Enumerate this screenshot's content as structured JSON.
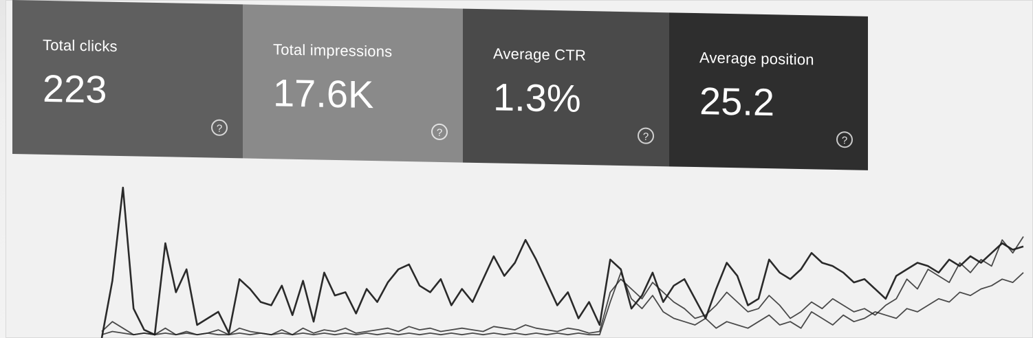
{
  "metrics": [
    {
      "label": "Total clicks",
      "value": "223"
    },
    {
      "label": "Total impressions",
      "value": "17.6K"
    },
    {
      "label": "Average CTR",
      "value": "1.3%"
    },
    {
      "label": "Average position",
      "value": "25.2"
    }
  ],
  "help_icon_glyph": "?",
  "chart_data": {
    "type": "line",
    "x": [
      1,
      2,
      3,
      4,
      5,
      6,
      7,
      8,
      9,
      10,
      11,
      12,
      13,
      14,
      15,
      16,
      17,
      18,
      19,
      20,
      21,
      22,
      23,
      24,
      25,
      26,
      27,
      28,
      29,
      30,
      31,
      32,
      33,
      34,
      35,
      36,
      37,
      38,
      39,
      40,
      41,
      42,
      43,
      44,
      45,
      46,
      47,
      48,
      49,
      50,
      51,
      52,
      53,
      54,
      55,
      56,
      57,
      58,
      59,
      60,
      61,
      62,
      63,
      64,
      65,
      66,
      67,
      68,
      69,
      70,
      71,
      72,
      73,
      74,
      75,
      76,
      77,
      78,
      79,
      80,
      81,
      82,
      83,
      84,
      85,
      86,
      87,
      88
    ],
    "series": [
      {
        "values": [
          0.0,
          0.35,
          0.92,
          0.18,
          0.05,
          0.02,
          0.58,
          0.28,
          0.42,
          0.08,
          0.12,
          0.16,
          0.03,
          0.36,
          0.3,
          0.22,
          0.2,
          0.32,
          0.14,
          0.35,
          0.1,
          0.4,
          0.26,
          0.28,
          0.15,
          0.3,
          0.22,
          0.34,
          0.42,
          0.45,
          0.32,
          0.28,
          0.36,
          0.2,
          0.3,
          0.22,
          0.36,
          0.5,
          0.38,
          0.46,
          0.6,
          0.48,
          0.34,
          0.2,
          0.28,
          0.12,
          0.22,
          0.08,
          0.48,
          0.42,
          0.18,
          0.26,
          0.4,
          0.22,
          0.32,
          0.36,
          0.24,
          0.12,
          0.3,
          0.46,
          0.38,
          0.2,
          0.24,
          0.48,
          0.4,
          0.36,
          0.42,
          0.52,
          0.46,
          0.44,
          0.4,
          0.34,
          0.36,
          0.3,
          0.24,
          0.38,
          0.42,
          0.46,
          0.44,
          0.4,
          0.48,
          0.44,
          0.5,
          0.46,
          0.52,
          0.58,
          0.54,
          0.56
        ]
      },
      {
        "values": [
          0.04,
          0.1,
          0.06,
          0.02,
          0.03,
          0.02,
          0.06,
          0.02,
          0.04,
          0.02,
          0.03,
          0.05,
          0.02,
          0.06,
          0.04,
          0.03,
          0.02,
          0.05,
          0.02,
          0.06,
          0.03,
          0.05,
          0.04,
          0.06,
          0.03,
          0.04,
          0.05,
          0.06,
          0.04,
          0.07,
          0.05,
          0.06,
          0.04,
          0.05,
          0.06,
          0.05,
          0.04,
          0.07,
          0.06,
          0.05,
          0.08,
          0.06,
          0.05,
          0.04,
          0.06,
          0.05,
          0.03,
          0.04,
          0.28,
          0.36,
          0.3,
          0.24,
          0.34,
          0.28,
          0.22,
          0.18,
          0.12,
          0.14,
          0.2,
          0.28,
          0.22,
          0.16,
          0.18,
          0.26,
          0.2,
          0.12,
          0.16,
          0.22,
          0.18,
          0.24,
          0.2,
          0.16,
          0.18,
          0.14,
          0.2,
          0.24,
          0.36,
          0.3,
          0.42,
          0.38,
          0.34,
          0.46,
          0.4,
          0.48,
          0.44,
          0.6,
          0.52,
          0.62
        ]
      },
      {
        "values": [
          0.02,
          0.04,
          0.03,
          0.02,
          0.03,
          0.02,
          0.03,
          0.02,
          0.03,
          0.02,
          0.03,
          0.02,
          0.02,
          0.03,
          0.02,
          0.03,
          0.02,
          0.03,
          0.02,
          0.03,
          0.02,
          0.03,
          0.02,
          0.03,
          0.02,
          0.03,
          0.02,
          0.03,
          0.02,
          0.03,
          0.02,
          0.03,
          0.02,
          0.03,
          0.02,
          0.03,
          0.02,
          0.03,
          0.02,
          0.03,
          0.02,
          0.03,
          0.02,
          0.03,
          0.02,
          0.03,
          0.02,
          0.02,
          0.22,
          0.4,
          0.24,
          0.18,
          0.26,
          0.16,
          0.12,
          0.1,
          0.08,
          0.12,
          0.06,
          0.1,
          0.08,
          0.06,
          0.1,
          0.14,
          0.08,
          0.1,
          0.06,
          0.16,
          0.12,
          0.08,
          0.14,
          0.1,
          0.12,
          0.16,
          0.14,
          0.12,
          0.18,
          0.16,
          0.2,
          0.24,
          0.22,
          0.28,
          0.26,
          0.3,
          0.32,
          0.36,
          0.34,
          0.4
        ]
      }
    ],
    "ylim": [
      0,
      1
    ],
    "grid": false
  },
  "colors": {
    "card_1": "#5f5f5f",
    "card_2": "#8a8a8a",
    "card_3": "#4a4a4a",
    "card_4": "#2e2e2e",
    "line": "#1f1f1f"
  }
}
